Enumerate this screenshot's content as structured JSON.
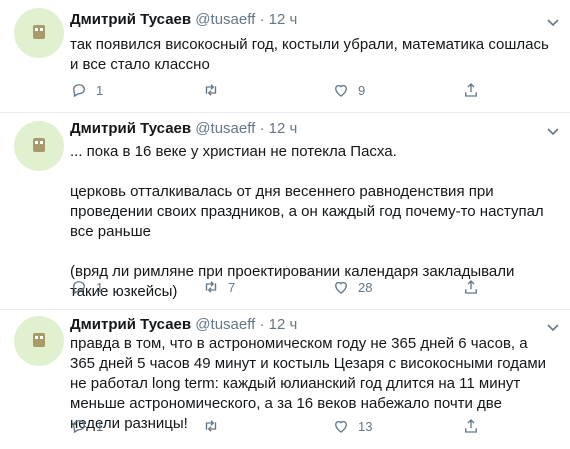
{
  "tweets": [
    {
      "name": "Дмитрий Тусаев",
      "handle": "@tusaeff",
      "separator": "·",
      "time": "12 ч",
      "paragraphs": [
        "так появился високосный год, костыли убрали, математика сошлась и все стало классно"
      ],
      "reply_count": "1",
      "retweet_count": "",
      "like_count": "9"
    },
    {
      "name": "Дмитрий Тусаев",
      "handle": "@tusaeff",
      "separator": "·",
      "time": "12 ч",
      "paragraphs": [
        "... пока в 16 веке у христиан не потекла Пасха.",
        "церковь отталкивалась от дня весеннего равноденствия при проведении своих  праздников, а он каждый год почему-то наступал все раньше",
        "(вряд ли римляне при проектировании календаря закладывали такие юзкейсы)"
      ],
      "reply_count": "1",
      "retweet_count": "7",
      "like_count": "28"
    },
    {
      "name": "Дмитрий Тусаев",
      "handle": "@tusaeff",
      "separator": "·",
      "time": "12 ч",
      "paragraphs": [
        "правда в том, что в астрономическом году не 365 дней 6 часов, а 365 дней 5 часов 49 минут и костыль Цезаря с високосными годами не работал long term: каждый юлианский год длится на 11 минут меньше астрономического, а за 16 веков набежало почти две недели разницы!"
      ],
      "reply_count": "1",
      "retweet_count": "",
      "like_count": "13"
    }
  ],
  "icons": {
    "reply": "reply-icon",
    "retweet": "retweet-icon",
    "like": "like-icon",
    "share": "share-icon",
    "more": "chevron-down-icon"
  },
  "colors": {
    "text": "#14171a",
    "secondary": "#657786",
    "divider": "#e6ecf0",
    "avatar_bg": "#dff1cf"
  }
}
